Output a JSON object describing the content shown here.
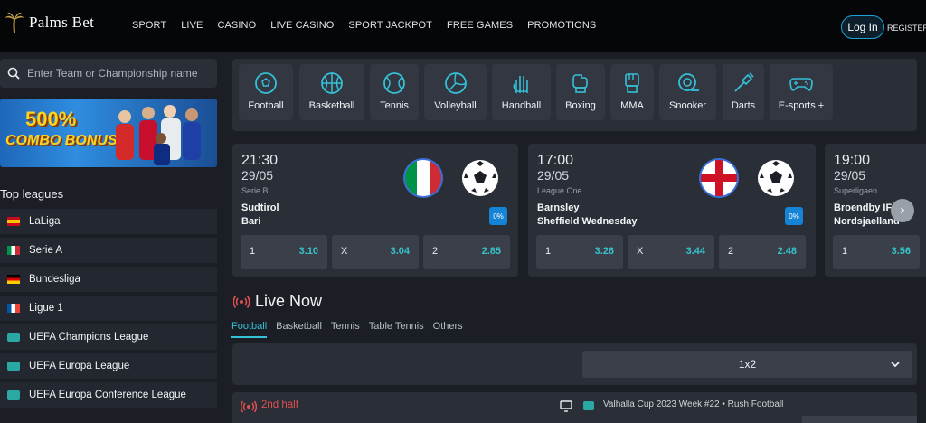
{
  "header": {
    "brand": "Palms Bet",
    "nav": [
      "SPORT",
      "LIVE",
      "CASINO",
      "LIVE CASINO",
      "SPORT JACKPOT",
      "FREE GAMES",
      "PROMOTIONS"
    ],
    "login": "Log In",
    "register": "REGISTER"
  },
  "sidebar": {
    "search_placeholder": "Enter Team or Championship name",
    "promo": {
      "line1": "500%",
      "line2": "COMBO BONUS"
    },
    "top_leagues_title": "Top leagues",
    "leagues": [
      {
        "label": "LaLiga",
        "flag": "spain"
      },
      {
        "label": "Serie A",
        "flag": "italy"
      },
      {
        "label": "Bundesliga",
        "flag": "germany"
      },
      {
        "label": "Ligue 1",
        "flag": "france"
      },
      {
        "label": "UEFA Champions League",
        "flag": "uefa"
      },
      {
        "label": "UEFA Europa League",
        "flag": "uefa"
      },
      {
        "label": "UEFA Europa Conference League",
        "flag": "uefa"
      }
    ]
  },
  "sports": [
    {
      "label": "Football",
      "icon": "football-icon"
    },
    {
      "label": "Basketball",
      "icon": "basketball-icon"
    },
    {
      "label": "Tennis",
      "icon": "tennis-icon"
    },
    {
      "label": "Volleyball",
      "icon": "volleyball-icon"
    },
    {
      "label": "Handball",
      "icon": "handball-icon"
    },
    {
      "label": "Boxing",
      "icon": "boxing-icon"
    },
    {
      "label": "MMA",
      "icon": "mma-icon"
    },
    {
      "label": "Snooker",
      "icon": "snooker-icon"
    },
    {
      "label": "Darts",
      "icon": "darts-icon"
    },
    {
      "label": "E-sports +",
      "icon": "gamepad-icon"
    }
  ],
  "matches": [
    {
      "time": "21:30",
      "date": "29/05",
      "competition": "Serie B",
      "home": "Sudtirol",
      "away": "Bari",
      "badge": "0%",
      "flag": "italy",
      "odds": [
        {
          "k": "1",
          "v": "3.10"
        },
        {
          "k": "X",
          "v": "3.04"
        },
        {
          "k": "2",
          "v": "2.85"
        }
      ]
    },
    {
      "time": "17:00",
      "date": "29/05",
      "competition": "League One",
      "home": "Barnsley",
      "away": "Sheffield Wednesday",
      "badge": "0%",
      "flag": "england",
      "odds": [
        {
          "k": "1",
          "v": "3.26"
        },
        {
          "k": "X",
          "v": "3.44"
        },
        {
          "k": "2",
          "v": "2.48"
        }
      ]
    },
    {
      "time": "19:00",
      "date": "29/05",
      "competition": "Superligaen",
      "home": "Broendby IF",
      "away": "Nordsjaelland",
      "odds": [
        {
          "k": "1",
          "v": "3.56"
        }
      ]
    }
  ],
  "live": {
    "title": "Live Now",
    "tabs": [
      "Football",
      "Basketball",
      "Tennis",
      "Table Tennis",
      "Others"
    ],
    "market": "1x2",
    "row": {
      "status": "2nd half",
      "event": "Valhalla Cup 2023 Week #22 • Rush Football"
    }
  },
  "colors": {
    "accent": "#35c0d6",
    "live_red": "#e24f4f",
    "odds": "#36c2c8",
    "badge": "#1583d6"
  }
}
